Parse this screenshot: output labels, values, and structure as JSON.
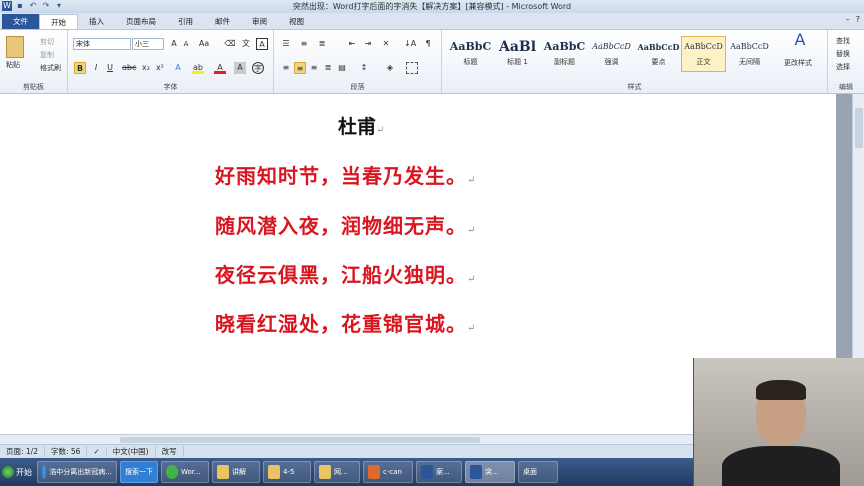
{
  "window": {
    "title": "突然出现：Word打字后面的字消失【解决方案】[兼容模式] - Microsoft Word"
  },
  "tabs": [
    "文件",
    "开始",
    "插入",
    "页面布局",
    "引用",
    "邮件",
    "审阅",
    "视图"
  ],
  "ribbon": {
    "clipboard": {
      "paste": "粘贴",
      "cut": "剪切",
      "copy": "复制",
      "format_painter": "格式刷",
      "label": "剪贴板"
    },
    "font": {
      "name": "宋体",
      "size": "小三",
      "label": "字体"
    },
    "paragraph": {
      "label": "段落"
    },
    "styles": {
      "label": "样式",
      "items": [
        {
          "sample": "AaBbC",
          "name": "标题"
        },
        {
          "sample": "AaBl",
          "name": "标题 1"
        },
        {
          "sample": "AaBbC",
          "name": "副标题"
        },
        {
          "sample": "AaBbCcD",
          "name": "强调"
        },
        {
          "sample": "AaBbCcD",
          "name": "要点"
        },
        {
          "sample": "AaBbCcD",
          "name": "正文"
        },
        {
          "sample": "AaBbCcD",
          "name": "无间隔"
        }
      ],
      "change_styles": "更改样式"
    },
    "editing": {
      "find": "查找",
      "replace": "替换",
      "select": "选择",
      "label": "编辑"
    }
  },
  "document": {
    "title": "杜甫",
    "lines": [
      "好雨知时节，当春乃发生。",
      "随风潜入夜，润物细无声。",
      "夜径云俱黑，江船火独明。",
      "晓看红湿处，花重锦官城。"
    ],
    "para_mark": "↵"
  },
  "status": {
    "page": "页面: 1/2",
    "words": "字数: 56",
    "language": "中文(中国)",
    "mode": "改写"
  },
  "taskbar": {
    "start": "开始",
    "items": [
      {
        "label": "浩中分离出新冠病...",
        "icon": "ie-icon"
      },
      {
        "label": "搜索一下",
        "icon": "search"
      },
      {
        "label": "Wor...",
        "icon": "ie-icon"
      },
      {
        "label": "讲解",
        "icon": "folder-icon"
      },
      {
        "label": "4-5",
        "icon": "folder-icon"
      },
      {
        "label": "网...",
        "icon": "folder-icon"
      },
      {
        "label": "c-can",
        "icon": "app-icon"
      },
      {
        "label": "案...",
        "icon": "word-icon"
      },
      {
        "label": "突...",
        "icon": "word-icon"
      }
    ],
    "tray": "桌面"
  }
}
